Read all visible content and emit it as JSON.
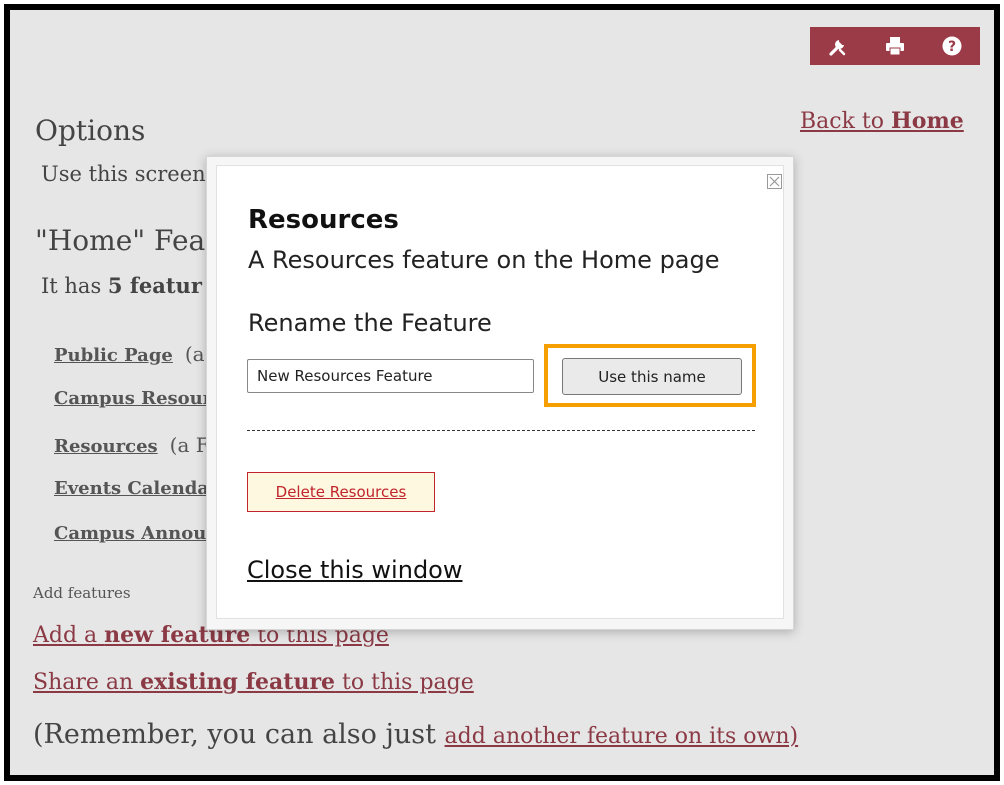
{
  "toolbar": {
    "accent": "#9c3b48",
    "icons": [
      "wrench-icon",
      "print-icon",
      "help-icon"
    ]
  },
  "header": {
    "back_prefix": "Back to ",
    "back_target": "Home"
  },
  "options": {
    "title": "Options",
    "description": "Use this screen"
  },
  "home_section": {
    "title": "\"Home\" Fea",
    "desc_prefix": "It has ",
    "desc_bold": "5 featur"
  },
  "features": [
    {
      "label": "Public Page",
      "note": "(a"
    },
    {
      "label": "Campus Resour",
      "note": ""
    },
    {
      "label": "Resources",
      "note": "(a F"
    },
    {
      "label": "Events Calenda",
      "note": ""
    },
    {
      "label": "Campus Annou",
      "note": ""
    }
  ],
  "add_features": {
    "label": "Add features",
    "new_prefix": "Add a ",
    "new_bold": "new feature",
    "new_suffix": " to this page",
    "share_prefix": "Share an ",
    "share_bold": "existing feature",
    "share_suffix": " to this page",
    "remember_text": "(Remember, you can also just ",
    "remember_link": "add another feature on its own)"
  },
  "modal": {
    "title": "Resources",
    "subtitle": "A Resources feature on the Home page",
    "rename_heading": "Rename the Feature",
    "name_value": "New Resources Feature",
    "use_name_label": "Use this name",
    "delete_label": "Delete Resources",
    "close_label": "Close this window",
    "highlight_color": "#f5a000",
    "delete_color": "#c0242c"
  }
}
